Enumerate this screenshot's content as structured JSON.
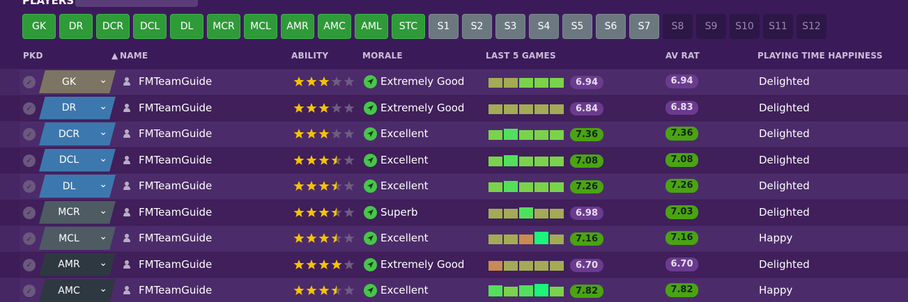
{
  "section_title": "PLAYERS",
  "positions": [
    {
      "label": "GK",
      "state": "green"
    },
    {
      "label": "DR",
      "state": "green"
    },
    {
      "label": "DCR",
      "state": "green"
    },
    {
      "label": "DCL",
      "state": "green"
    },
    {
      "label": "DL",
      "state": "green"
    },
    {
      "label": "MCR",
      "state": "green"
    },
    {
      "label": "MCL",
      "state": "green"
    },
    {
      "label": "AMR",
      "state": "green"
    },
    {
      "label": "AMC",
      "state": "green"
    },
    {
      "label": "AML",
      "state": "green"
    },
    {
      "label": "STC",
      "state": "green"
    },
    {
      "label": "S1",
      "state": "grey"
    },
    {
      "label": "S2",
      "state": "grey"
    },
    {
      "label": "S3",
      "state": "grey"
    },
    {
      "label": "S4",
      "state": "grey"
    },
    {
      "label": "S5",
      "state": "grey"
    },
    {
      "label": "S6",
      "state": "grey"
    },
    {
      "label": "S7",
      "state": "grey"
    },
    {
      "label": "S8",
      "state": "dark"
    },
    {
      "label": "S9",
      "state": "dark"
    },
    {
      "label": "S10",
      "state": "dark"
    },
    {
      "label": "S11",
      "state": "dark"
    },
    {
      "label": "S12",
      "state": "dark"
    }
  ],
  "columns": {
    "pkd": "PKD",
    "name": "NAME",
    "ability": "ABILITY",
    "morale": "MORALE",
    "last5": "LAST 5 GAMES",
    "avrat": "AV RAT",
    "happiness": "PLAYING TIME HAPPINESS"
  },
  "sort_icon": "sort-up-icon",
  "colors": {
    "green_button": "#2f9a38",
    "grey_button": "#6b7880",
    "background": "#3b1a5a",
    "rating_purple": "#6a3b8e",
    "rating_green": "#4aa313"
  },
  "players": [
    {
      "pos": "GK",
      "pos_style": "gk",
      "name": "FMTeamGuide",
      "stars": 3,
      "morale": "Extremely Good",
      "games": [
        "olive",
        "olive",
        "lime",
        "lime",
        "lime"
      ],
      "last_rating": "6.94",
      "last_badge": "purple",
      "avrat": "6.94",
      "avrat_badge": "purple",
      "happiness": "Delighted"
    },
    {
      "pos": "DR",
      "pos_style": "def",
      "name": "FMTeamGuide",
      "stars": 3,
      "morale": "Extremely Good",
      "games": [
        "olive",
        "olive",
        "olive",
        "olive",
        "olive"
      ],
      "last_rating": "6.84",
      "last_badge": "purple",
      "avrat": "6.83",
      "avrat_badge": "purple",
      "happiness": "Delighted"
    },
    {
      "pos": "DCR",
      "pos_style": "def",
      "name": "FMTeamGuide",
      "stars": 3,
      "morale": "Excellent",
      "games": [
        "lime",
        "green",
        "lime",
        "lime",
        "lime"
      ],
      "last_rating": "7.36",
      "last_badge": "green",
      "avrat": "7.36",
      "avrat_badge": "green",
      "happiness": "Delighted"
    },
    {
      "pos": "DCL",
      "pos_style": "def",
      "name": "FMTeamGuide",
      "stars": 3.5,
      "morale": "Excellent",
      "games": [
        "lime",
        "green",
        "lime",
        "lime",
        "lime"
      ],
      "last_rating": "7.08",
      "last_badge": "green",
      "avrat": "7.08",
      "avrat_badge": "green",
      "happiness": "Delighted"
    },
    {
      "pos": "DL",
      "pos_style": "def",
      "name": "FMTeamGuide",
      "stars": 3.5,
      "morale": "Excellent",
      "games": [
        "lime",
        "green",
        "lime",
        "lime",
        "lime"
      ],
      "last_rating": "7.26",
      "last_badge": "green",
      "avrat": "7.26",
      "avrat_badge": "green",
      "happiness": "Delighted"
    },
    {
      "pos": "MCR",
      "pos_style": "mid",
      "name": "FMTeamGuide",
      "stars": 3.5,
      "morale": "Superb",
      "games": [
        "olive",
        "olive",
        "green",
        "olive",
        "olive"
      ],
      "last_rating": "6.98",
      "last_badge": "purple",
      "avrat": "7.03",
      "avrat_badge": "green",
      "happiness": "Delighted"
    },
    {
      "pos": "MCL",
      "pos_style": "mid",
      "name": "FMTeamGuide",
      "stars": 3.5,
      "morale": "Excellent",
      "games": [
        "olive",
        "olive",
        "orange",
        "bright",
        "olive"
      ],
      "last_rating": "7.16",
      "last_badge": "green",
      "avrat": "7.16",
      "avrat_badge": "green",
      "happiness": "Happy"
    },
    {
      "pos": "AMR",
      "pos_style": "att",
      "name": "FMTeamGuide",
      "stars": 4,
      "morale": "Extremely Good",
      "games": [
        "orange",
        "olive",
        "olive",
        "olive",
        "olive"
      ],
      "last_rating": "6.70",
      "last_badge": "purple",
      "avrat": "6.70",
      "avrat_badge": "purple",
      "happiness": "Delighted"
    },
    {
      "pos": "AMC",
      "pos_style": "att",
      "name": "FMTeamGuide",
      "stars": 3.5,
      "morale": "Excellent",
      "games": [
        "green",
        "lime",
        "green",
        "bright",
        "lime"
      ],
      "last_rating": "7.82",
      "last_badge": "green",
      "avrat": "7.82",
      "avrat_badge": "green",
      "happiness": "Happy"
    }
  ]
}
